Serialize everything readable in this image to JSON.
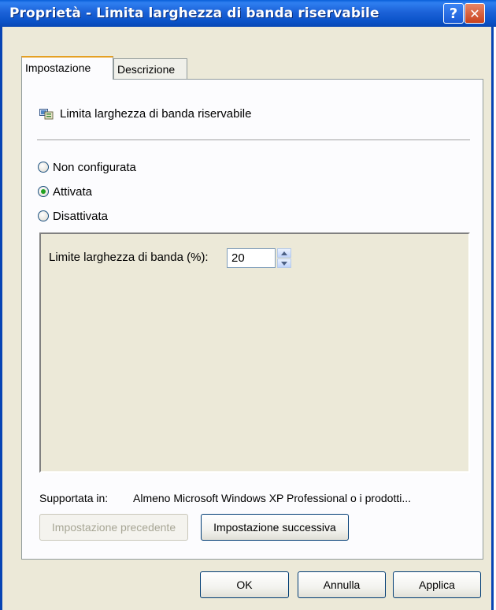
{
  "window": {
    "title": "Proprietà - Limita larghezza di banda riservabile",
    "help_glyph": "?",
    "close_glyph": "✕"
  },
  "tabs": [
    {
      "label": "Impostazione",
      "active": true
    },
    {
      "label": "Descrizione",
      "active": false
    }
  ],
  "setting": {
    "title": "Limita larghezza di banda riservabile",
    "icon": "group-policy-setting-icon",
    "state_options": [
      {
        "label": "Non configurata",
        "checked": false
      },
      {
        "label": "Attivata",
        "checked": true
      },
      {
        "label": "Disattivata",
        "checked": false
      }
    ],
    "options": {
      "bandwidth_label": "Limite larghezza di banda (%):",
      "bandwidth_value": "20"
    },
    "supported_label": "Supportata in:",
    "supported_value": "Almeno Microsoft Windows XP Professional o i prodotti..."
  },
  "nav": {
    "previous_label": "Impostazione precedente",
    "next_label": "Impostazione successiva"
  },
  "footer": {
    "ok_label": "OK",
    "cancel_label": "Annulla",
    "apply_label": "Applica"
  },
  "colors": {
    "titlebar": "#0a52c8",
    "dialog_face": "#ece9d8",
    "tab_highlight": "#e5a023",
    "radio_dot": "#21a121"
  }
}
